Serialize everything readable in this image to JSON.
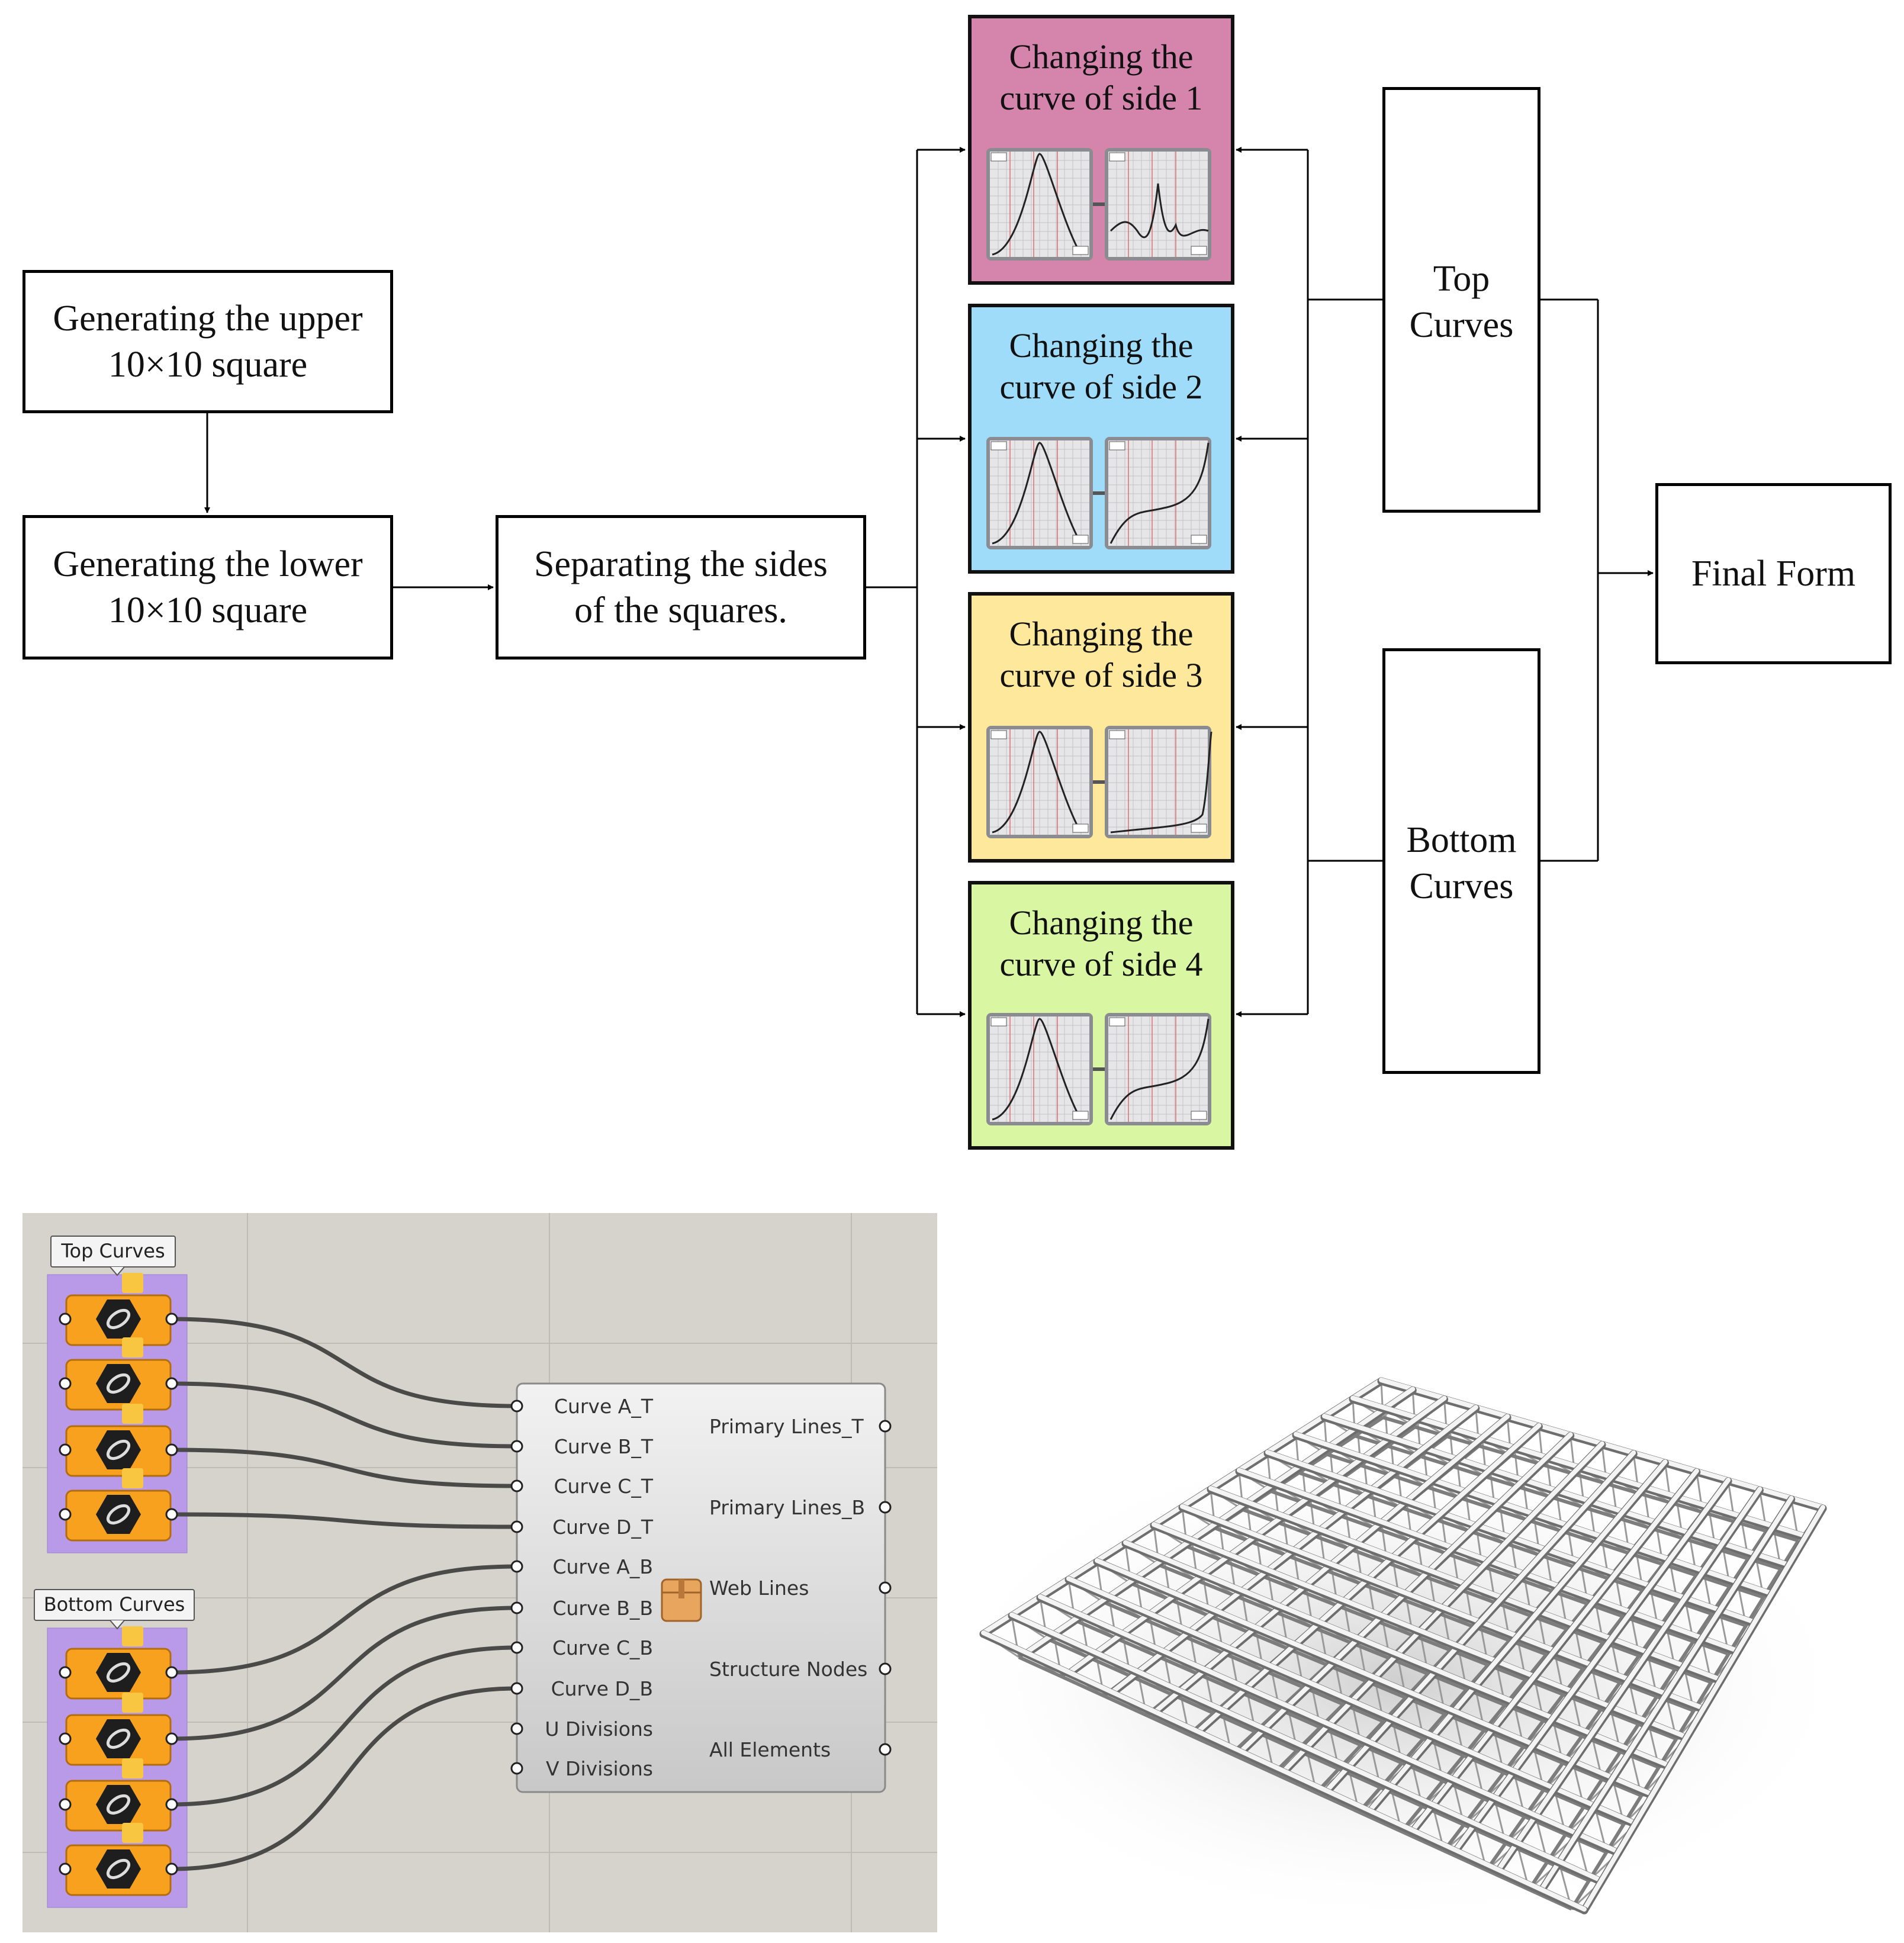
{
  "flowchart": {
    "upper_square": [
      "Generating the upper",
      "10×10 square"
    ],
    "lower_square": [
      "Generating the lower",
      "10×10 square"
    ],
    "separating": [
      "Separating the sides",
      "of the squares."
    ],
    "sides": [
      {
        "label": [
          "Changing the",
          "curve of side 1"
        ],
        "color": "#d584ac"
      },
      {
        "label": [
          "Changing the",
          "curve of side 2"
        ],
        "color": "#9fdcf9"
      },
      {
        "label": [
          "Changing the",
          "curve of side 3"
        ],
        "color": "#fde89c"
      },
      {
        "label": [
          "Changing the",
          "curve of side 4"
        ],
        "color": "#d9f7a3"
      }
    ],
    "top_curves": [
      "Top",
      "Curves"
    ],
    "bottom_curves": [
      "Bottom",
      "Curves"
    ],
    "final_form": "Final Form"
  },
  "grasshopper": {
    "group_top_label": "Top Curves",
    "group_bottom_label": "Bottom Curves",
    "group_color": "#b99ae8",
    "param_color": "#f7a11e",
    "inputs": [
      "Curve A_T",
      "Curve B_T",
      "Curve C_T",
      "Curve D_T",
      "Curve A_B",
      "Curve B_B",
      "Curve C_B",
      "Curve D_B",
      "U Divisions",
      "V Divisions"
    ],
    "outputs": [
      "Primary Lines_T",
      "Primary Lines_B",
      "Web Lines",
      "Structure Nodes",
      "All Elements"
    ],
    "component_icon": "box-package-icon",
    "param_icon": "curve-param-icon"
  },
  "render": {
    "grid_divisions": 14
  }
}
